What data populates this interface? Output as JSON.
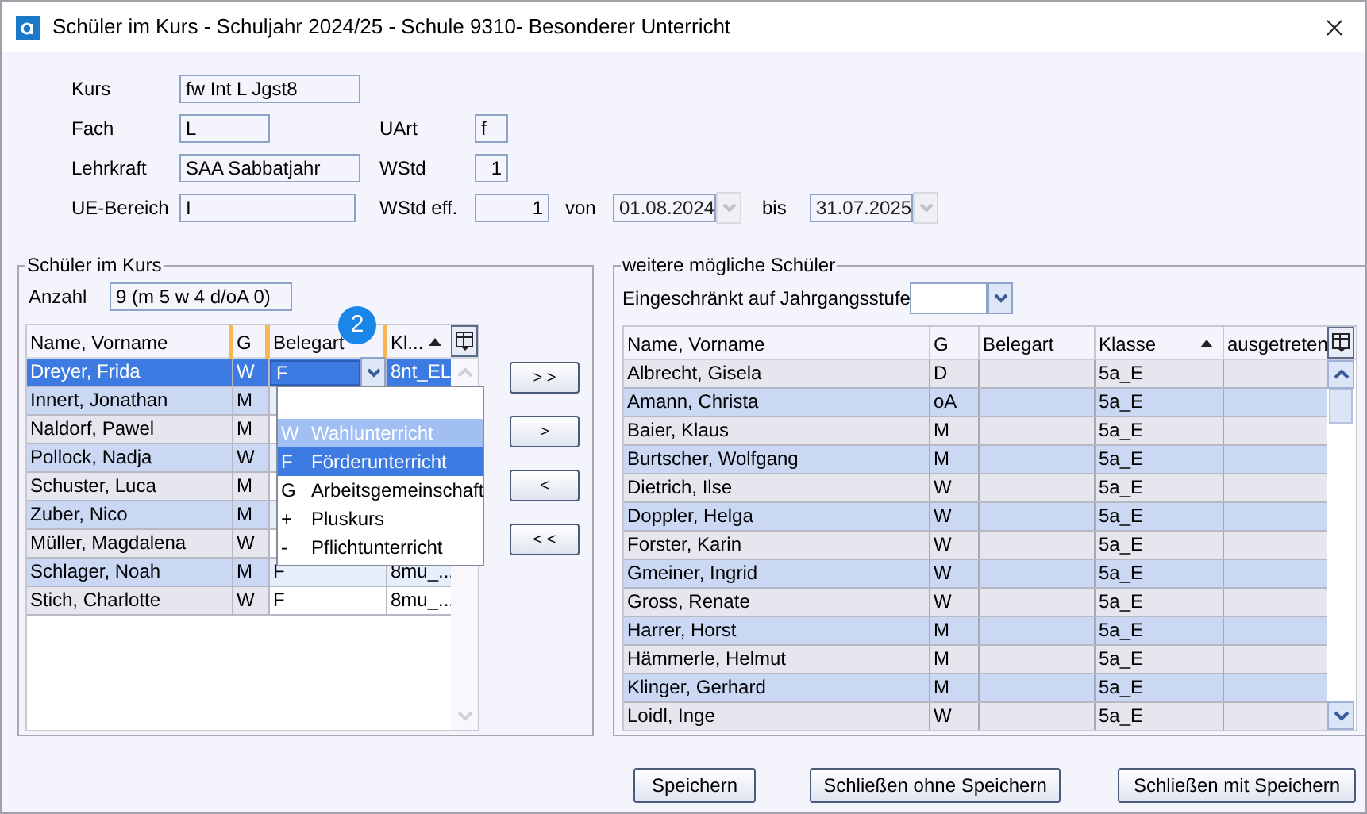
{
  "window": {
    "title": "Schüler im Kurs - Schuljahr 2024/25 - Schule 9310- Besonderer Unterricht"
  },
  "form": {
    "kurs": {
      "label": "Kurs",
      "value": "fw Int L Jgst8"
    },
    "fach": {
      "label": "Fach",
      "value": "L"
    },
    "uart": {
      "label": "UArt",
      "value": "f"
    },
    "lehrkraft": {
      "label": "Lehrkraft",
      "value": "SAA Sabbatjahr"
    },
    "wstd": {
      "label": "WStd",
      "value": "1"
    },
    "ue_bereich": {
      "label": "UE-Bereich",
      "value": "I"
    },
    "wstd_eff": {
      "label": "WStd eff.",
      "value": "1"
    },
    "von": {
      "label": "von",
      "value": "01.08.2024",
      "disabled": true
    },
    "bis": {
      "label": "bis",
      "value": "31.07.2025",
      "disabled": true
    }
  },
  "enrolled": {
    "title": "Schüler im Kurs",
    "count_label": "Anzahl",
    "count": "9 (m 5 w 4 d/oA 0)",
    "badge": "2",
    "columns": [
      {
        "label": "Name, Vorname",
        "sorted": false
      },
      {
        "label": "G",
        "sorted": false
      },
      {
        "label": "Belegart",
        "sorted": false
      },
      {
        "label": "Kl...",
        "sorted": true
      }
    ],
    "rows": [
      {
        "name": "Dreyer, Frida",
        "g": "W",
        "belegart": "F",
        "klasse": "8nt_EL",
        "selected": true
      },
      {
        "name": "Innert, Jonathan",
        "g": "M",
        "selected": false
      },
      {
        "name": "Naldorf, Pawel",
        "g": "M",
        "selected": false
      },
      {
        "name": "Pollock, Nadja",
        "g": "W",
        "selected": false
      },
      {
        "name": "Schuster, Luca",
        "g": "M",
        "selected": false
      },
      {
        "name": "Zuber, Nico",
        "g": "M",
        "selected": false
      },
      {
        "name": "Müller, Magdalena",
        "g": "W",
        "selected": false
      },
      {
        "name": "Schlager, Noah",
        "g": "M",
        "belegart": "F",
        "klasse": "8mu_...",
        "selected": false
      },
      {
        "name": "Stich, Charlotte",
        "g": "W",
        "belegart": "F",
        "klasse": "8mu_...",
        "selected": false
      }
    ],
    "dropdown": {
      "items": [
        {
          "code": "W",
          "label": "Wahlunterricht",
          "selected": false,
          "hovered": true
        },
        {
          "code": "F",
          "label": "Förderunterricht",
          "selected": true,
          "hovered": false
        },
        {
          "code": "G",
          "label": "Arbeitsgemeinschaft",
          "selected": false,
          "hovered": false
        },
        {
          "code": "+",
          "label": "Pluskurs",
          "selected": false,
          "hovered": false
        },
        {
          "code": "-",
          "label": "Pflichtunterricht",
          "selected": false,
          "hovered": false
        }
      ]
    }
  },
  "transfer_buttons": [
    "> >",
    ">",
    "<",
    "< <"
  ],
  "candidates": {
    "title": "weitere mögliche Schüler",
    "filter_label": "Eingeschränkt auf Jahrgangsstufe",
    "columns": [
      {
        "label": "Name, Vorname",
        "sorted": false
      },
      {
        "label": "G",
        "sorted": false
      },
      {
        "label": "Belegart",
        "sorted": false
      },
      {
        "label": "Klasse",
        "sorted": true
      },
      {
        "label": "ausgetreten",
        "sorted": false
      }
    ],
    "rows": [
      {
        "name": "Albrecht, Gisela",
        "g": "D",
        "klasse": "5a_E"
      },
      {
        "name": "Amann, Christa",
        "g": "oA",
        "klasse": "5a_E"
      },
      {
        "name": "Baier, Klaus",
        "g": "M",
        "klasse": "5a_E"
      },
      {
        "name": "Burtscher, Wolfgang",
        "g": "M",
        "klasse": "5a_E"
      },
      {
        "name": "Dietrich, Ilse",
        "g": "W",
        "klasse": "5a_E"
      },
      {
        "name": "Doppler, Helga",
        "g": "W",
        "klasse": "5a_E"
      },
      {
        "name": "Forster, Karin",
        "g": "W",
        "klasse": "5a_E"
      },
      {
        "name": "Gmeiner, Ingrid",
        "g": "W",
        "klasse": "5a_E"
      },
      {
        "name": "Gross, Renate",
        "g": "W",
        "klasse": "5a_E"
      },
      {
        "name": "Harrer, Horst",
        "g": "M",
        "klasse": "5a_E"
      },
      {
        "name": "Hämmerle, Helmut",
        "g": "M",
        "klasse": "5a_E"
      },
      {
        "name": "Klinger, Gerhard",
        "g": "M",
        "klasse": "5a_E"
      },
      {
        "name": "Loidl, Inge",
        "g": "W",
        "klasse": "5a_E"
      }
    ]
  },
  "buttons": [
    "Speichern",
    "Schließen ohne Speichern",
    "Schließen mit Speichern"
  ]
}
